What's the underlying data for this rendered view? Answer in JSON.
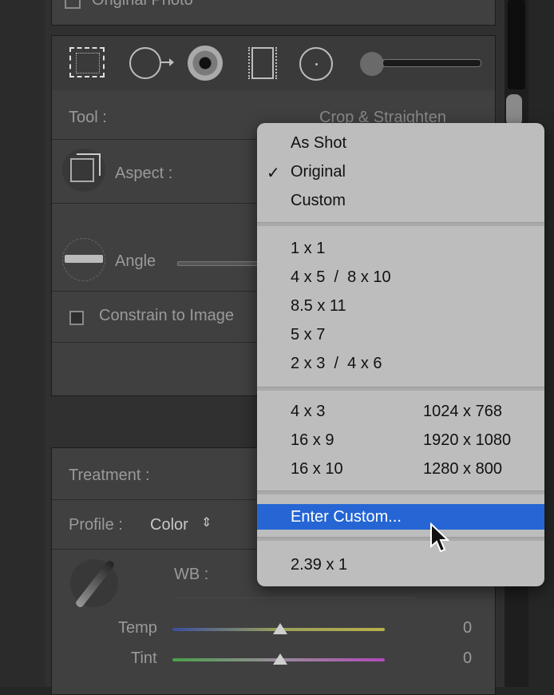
{
  "panel": {
    "original_photo_label": "Original Photo",
    "tool_label": "Tool :",
    "tool_value": "Crop & Straighten",
    "aspect_label": "Aspect :",
    "angle_label": "Angle",
    "constrain_label": "Constrain to Image",
    "treatment_label": "Treatment :",
    "profile_label": "Profile :",
    "profile_value": "Color",
    "wb_label": "WB :",
    "temp_label": "Temp",
    "temp_value": "0",
    "tint_label": "Tint",
    "tint_value": "0"
  },
  "tools": [
    "crop-overlay-icon",
    "spot-removal-icon",
    "red-eye-icon",
    "graduated-filter-icon",
    "radial-filter-icon",
    "adjustment-brush-icon"
  ],
  "menu": {
    "group1": [
      "As Shot",
      "Original",
      "Custom"
    ],
    "checked": "Original",
    "group2": [
      "1 x 1",
      "4 x 5  /  8 x 10",
      "8.5 x 11",
      "5 x 7",
      "2 x 3  /  4 x 6"
    ],
    "group3": [
      {
        "ratio": "4 x 3",
        "size": "1024 x 768"
      },
      {
        "ratio": "16 x 9",
        "size": "1920 x 1080"
      },
      {
        "ratio": "16 x 10",
        "size": "1280 x 800"
      }
    ],
    "enter_custom": "Enter Custom...",
    "last": "2.39 x 1",
    "check_mark": "✓"
  },
  "colors": {
    "highlight": "#2566d4",
    "menu_bg": "#bdbdbd"
  }
}
